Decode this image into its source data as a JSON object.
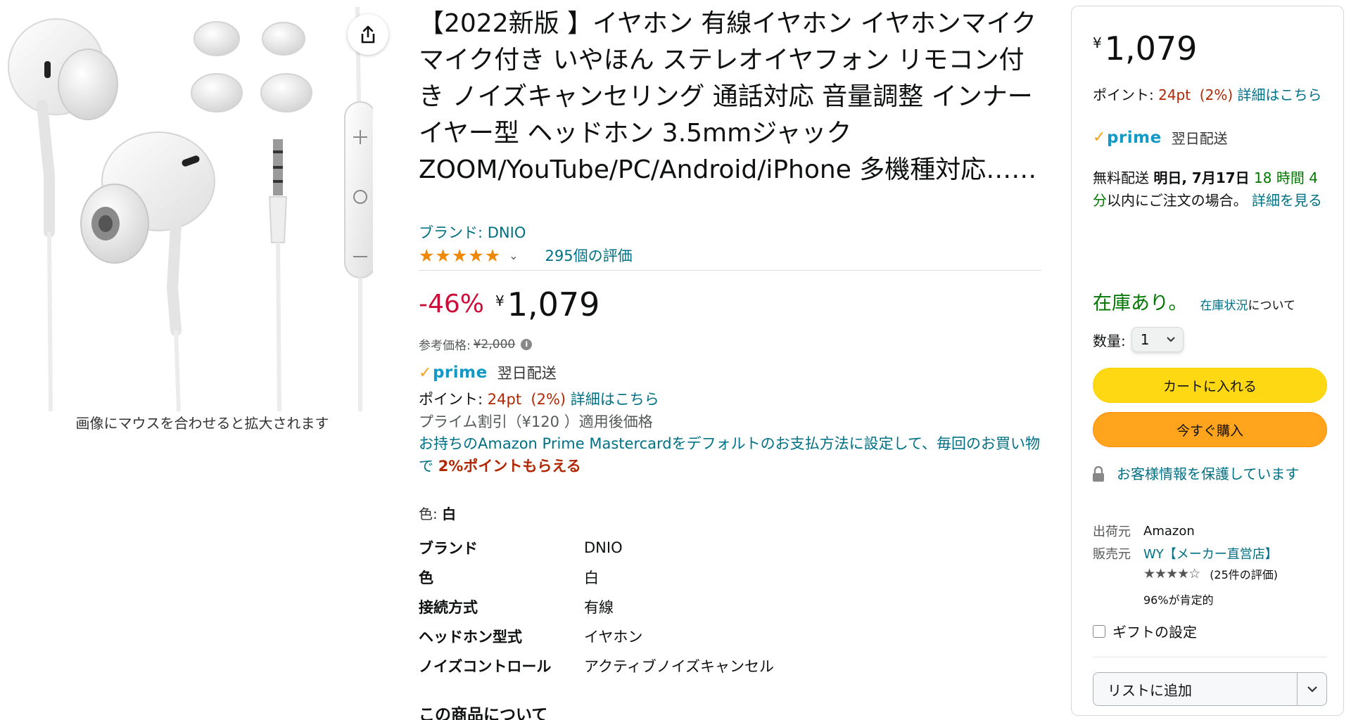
{
  "image": {
    "zoom_hint": "画像にマウスを合わせると拡大されます",
    "share_icon": "share-icon"
  },
  "product": {
    "title": "【2022新版 】イヤホン 有線イヤホン イヤホンマイク マイク付き いやほん ステレオイヤフォン リモコン付き ノイズキャンセリング 通話対応 音量調整 インナーイヤー型 ヘッドホン 3.5mmジャック ZOOM/YouTube/PC/Android/iPhone 多機種対応……",
    "brand_link": "ブランド: DNIO",
    "rating_stars": 5,
    "reviews_link": "295個の評価",
    "discount": "-46%",
    "currency": "¥",
    "price": "1,079",
    "reference_price_label": "参考価格:",
    "reference_price": "¥2,000",
    "prime_label": "prime",
    "delivery": "翌日配送",
    "points_label": "ポイント:",
    "points_value": "24pt  (2%)",
    "points_link": "詳細はこちら",
    "prime_discount": "プライム割引（¥120 ）適用後価格",
    "promo_text": "お持ちのAmazon Prime Mastercardをデフォルトのお支払方法に設定して、毎回のお買い物で",
    "promo_highlight": "2%ポイントもらえる",
    "color_label": "色:",
    "color_value": "白",
    "specs": [
      {
        "key": "ブランド",
        "value": "DNIO"
      },
      {
        "key": "色",
        "value": "白"
      },
      {
        "key": "接続方式",
        "value": "有線"
      },
      {
        "key": "ヘッドホン型式",
        "value": "イヤホン"
      },
      {
        "key": "ノイズコントロール",
        "value": "アクティブノイズキャンセル"
      }
    ],
    "about_heading": "この商品について"
  },
  "buybox": {
    "currency": "¥",
    "price": "1,079",
    "points_label": "ポイント:",
    "points_value": "24pt  (2%)",
    "points_link": "詳細はこちら",
    "prime_label": "prime",
    "delivery": "翌日配送",
    "shipping_prefix": "無料配送",
    "shipping_date": "明日, 7月17日",
    "shipping_countdown": "18 時間 4 分",
    "shipping_suffix": "以内にご注文の場合。",
    "shipping_link": "詳細を見る",
    "in_stock": "在庫あり。",
    "stock_link": "在庫状況",
    "stock_suffix": "について",
    "qty_label": "数量:",
    "qty_value": "1",
    "add_to_cart": "カートに入れる",
    "buy_now": "今すぐ購入",
    "secure_text": "お客様情報を保護しています",
    "shipper_label": "出荷元",
    "shipper_value": "Amazon",
    "seller_label": "販売元",
    "seller_value": "WY【メーカー直営店】",
    "seller_rating": 4.5,
    "seller_rating_count": "(25件の評価)",
    "seller_positive": "96%が肯定的",
    "gift_label": "ギフトの設定",
    "add_to_list": "リストに追加"
  },
  "colors": {
    "link": "#007185",
    "price_red": "#b12704",
    "discount_red": "#cc0c39",
    "in_stock_green": "#007600",
    "cart_yellow": "#ffd814",
    "buy_orange": "#ffa41c",
    "star_orange": "#f08804",
    "prime_blue": "#1399c6"
  }
}
